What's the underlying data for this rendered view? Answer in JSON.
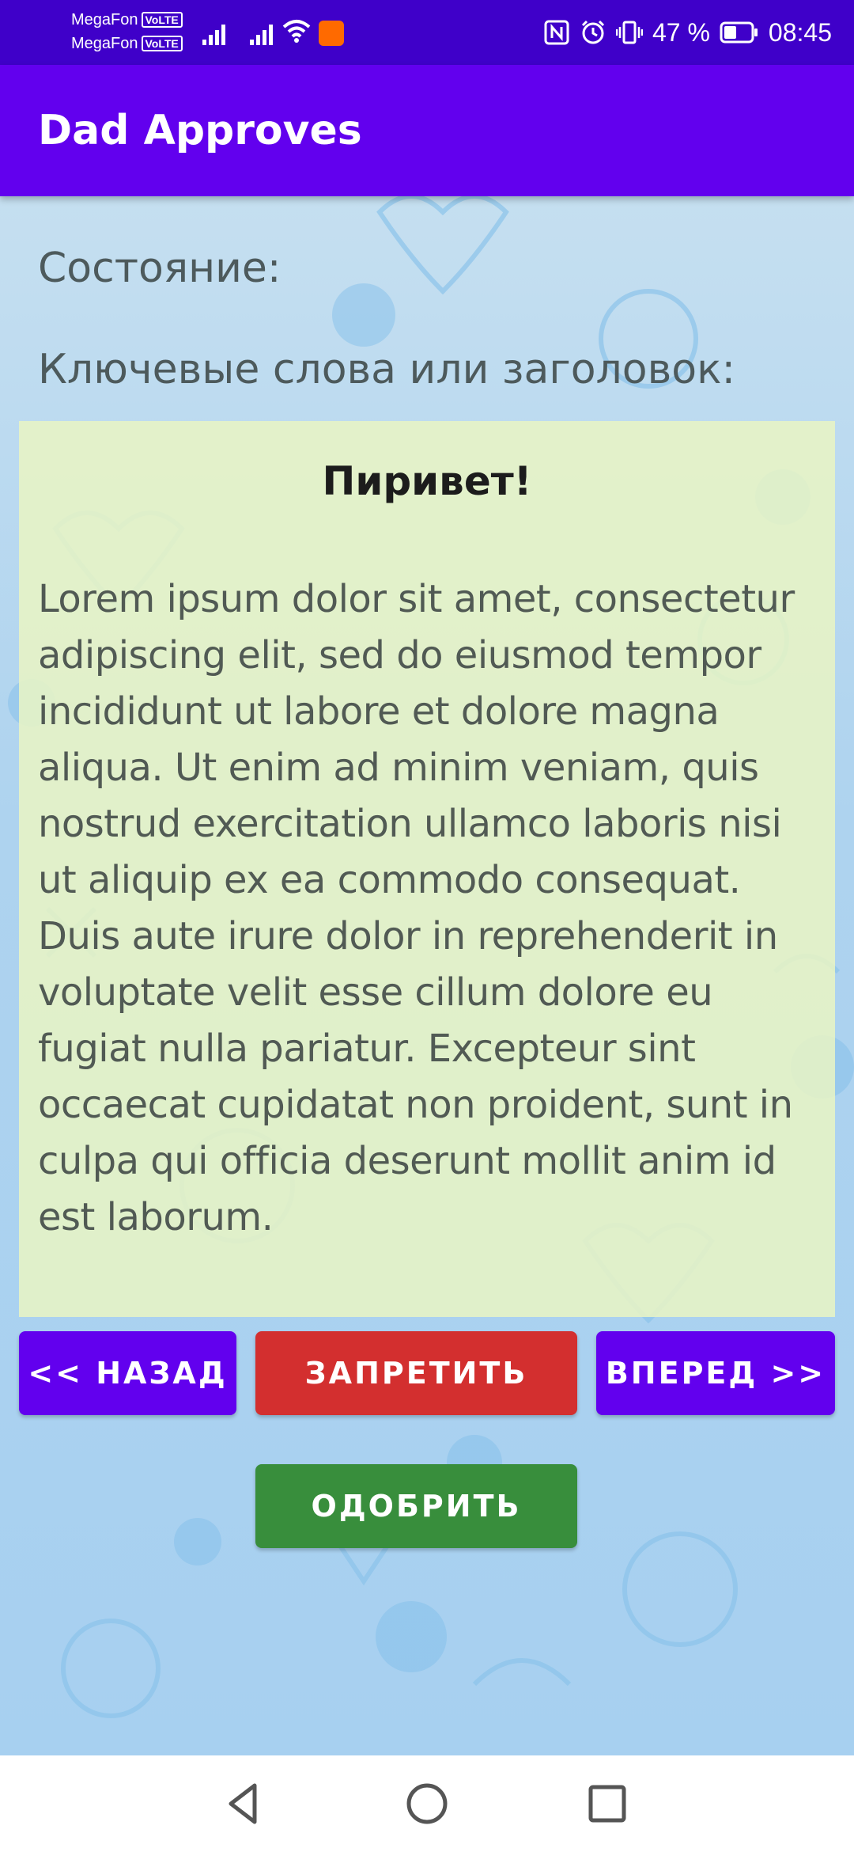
{
  "status_bar": {
    "carrier_1": "MegaFon",
    "carrier_2": "MegaFon",
    "volte_label": "VoLTE",
    "battery_percent": "47 %",
    "battery_level": 0.47,
    "time": "08:45",
    "icons": [
      "signal-icon",
      "wifi-icon",
      "app-notification-icon",
      "nfc-icon",
      "alarm-icon",
      "vibrate-icon",
      "battery-icon"
    ],
    "colors": {
      "background": "#3f00c9"
    }
  },
  "app_bar": {
    "title": "Dad Approves",
    "color": "#6200ee"
  },
  "main": {
    "state_label": "Состояние:",
    "keywords_label": "Ключевые слова или заголовок:",
    "message": {
      "title": "Пиривет!",
      "body": "Lorem ipsum dolor sit amet, consectetur adipiscing elit, sed do eiusmod tempor incididunt ut labore et dolore magna aliqua. Ut enim ad minim veniam, quis nostrud exercitation ullamco laboris nisi ut aliquip ex ea commodo consequat. Duis aute irure dolor in reprehenderit in voluptate velit esse cillum dolore eu fugiat nulla pariatur. Excepteur sint occaecat cupidatat non proident, sunt in culpa qui officia deserunt mollit anim id est laborum."
    },
    "buttons": {
      "back": "<< НАЗАД",
      "forbid": "ЗАПРЕТИТЬ",
      "forward": "ВПЕРЕД >>",
      "approve": "ОДОБРИТЬ"
    },
    "colors": {
      "primary": "#6200ee",
      "forbid": "#d32f2f",
      "approve": "#388e3c",
      "card": "#e9f5c4"
    }
  },
  "nav_bar": {
    "icons": [
      "back-icon",
      "home-icon",
      "recents-icon"
    ]
  }
}
